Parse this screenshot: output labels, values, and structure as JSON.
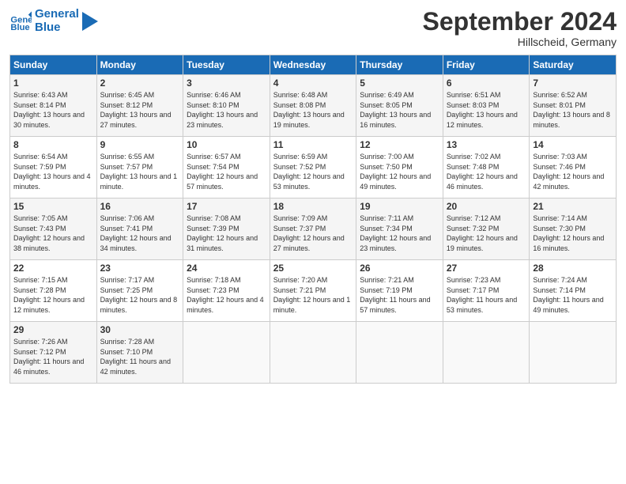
{
  "logo": {
    "general": "General",
    "blue": "Blue"
  },
  "header": {
    "title": "September 2024",
    "subtitle": "Hillscheid, Germany"
  },
  "columns": [
    "Sunday",
    "Monday",
    "Tuesday",
    "Wednesday",
    "Thursday",
    "Friday",
    "Saturday"
  ],
  "weeks": [
    [
      {
        "day": "1",
        "sunrise": "Sunrise: 6:43 AM",
        "sunset": "Sunset: 8:14 PM",
        "daylight": "Daylight: 13 hours and 30 minutes."
      },
      {
        "day": "2",
        "sunrise": "Sunrise: 6:45 AM",
        "sunset": "Sunset: 8:12 PM",
        "daylight": "Daylight: 13 hours and 27 minutes."
      },
      {
        "day": "3",
        "sunrise": "Sunrise: 6:46 AM",
        "sunset": "Sunset: 8:10 PM",
        "daylight": "Daylight: 13 hours and 23 minutes."
      },
      {
        "day": "4",
        "sunrise": "Sunrise: 6:48 AM",
        "sunset": "Sunset: 8:08 PM",
        "daylight": "Daylight: 13 hours and 19 minutes."
      },
      {
        "day": "5",
        "sunrise": "Sunrise: 6:49 AM",
        "sunset": "Sunset: 8:05 PM",
        "daylight": "Daylight: 13 hours and 16 minutes."
      },
      {
        "day": "6",
        "sunrise": "Sunrise: 6:51 AM",
        "sunset": "Sunset: 8:03 PM",
        "daylight": "Daylight: 13 hours and 12 minutes."
      },
      {
        "day": "7",
        "sunrise": "Sunrise: 6:52 AM",
        "sunset": "Sunset: 8:01 PM",
        "daylight": "Daylight: 13 hours and 8 minutes."
      }
    ],
    [
      {
        "day": "8",
        "sunrise": "Sunrise: 6:54 AM",
        "sunset": "Sunset: 7:59 PM",
        "daylight": "Daylight: 13 hours and 4 minutes."
      },
      {
        "day": "9",
        "sunrise": "Sunrise: 6:55 AM",
        "sunset": "Sunset: 7:57 PM",
        "daylight": "Daylight: 13 hours and 1 minute."
      },
      {
        "day": "10",
        "sunrise": "Sunrise: 6:57 AM",
        "sunset": "Sunset: 7:54 PM",
        "daylight": "Daylight: 12 hours and 57 minutes."
      },
      {
        "day": "11",
        "sunrise": "Sunrise: 6:59 AM",
        "sunset": "Sunset: 7:52 PM",
        "daylight": "Daylight: 12 hours and 53 minutes."
      },
      {
        "day": "12",
        "sunrise": "Sunrise: 7:00 AM",
        "sunset": "Sunset: 7:50 PM",
        "daylight": "Daylight: 12 hours and 49 minutes."
      },
      {
        "day": "13",
        "sunrise": "Sunrise: 7:02 AM",
        "sunset": "Sunset: 7:48 PM",
        "daylight": "Daylight: 12 hours and 46 minutes."
      },
      {
        "day": "14",
        "sunrise": "Sunrise: 7:03 AM",
        "sunset": "Sunset: 7:46 PM",
        "daylight": "Daylight: 12 hours and 42 minutes."
      }
    ],
    [
      {
        "day": "15",
        "sunrise": "Sunrise: 7:05 AM",
        "sunset": "Sunset: 7:43 PM",
        "daylight": "Daylight: 12 hours and 38 minutes."
      },
      {
        "day": "16",
        "sunrise": "Sunrise: 7:06 AM",
        "sunset": "Sunset: 7:41 PM",
        "daylight": "Daylight: 12 hours and 34 minutes."
      },
      {
        "day": "17",
        "sunrise": "Sunrise: 7:08 AM",
        "sunset": "Sunset: 7:39 PM",
        "daylight": "Daylight: 12 hours and 31 minutes."
      },
      {
        "day": "18",
        "sunrise": "Sunrise: 7:09 AM",
        "sunset": "Sunset: 7:37 PM",
        "daylight": "Daylight: 12 hours and 27 minutes."
      },
      {
        "day": "19",
        "sunrise": "Sunrise: 7:11 AM",
        "sunset": "Sunset: 7:34 PM",
        "daylight": "Daylight: 12 hours and 23 minutes."
      },
      {
        "day": "20",
        "sunrise": "Sunrise: 7:12 AM",
        "sunset": "Sunset: 7:32 PM",
        "daylight": "Daylight: 12 hours and 19 minutes."
      },
      {
        "day": "21",
        "sunrise": "Sunrise: 7:14 AM",
        "sunset": "Sunset: 7:30 PM",
        "daylight": "Daylight: 12 hours and 16 minutes."
      }
    ],
    [
      {
        "day": "22",
        "sunrise": "Sunrise: 7:15 AM",
        "sunset": "Sunset: 7:28 PM",
        "daylight": "Daylight: 12 hours and 12 minutes."
      },
      {
        "day": "23",
        "sunrise": "Sunrise: 7:17 AM",
        "sunset": "Sunset: 7:25 PM",
        "daylight": "Daylight: 12 hours and 8 minutes."
      },
      {
        "day": "24",
        "sunrise": "Sunrise: 7:18 AM",
        "sunset": "Sunset: 7:23 PM",
        "daylight": "Daylight: 12 hours and 4 minutes."
      },
      {
        "day": "25",
        "sunrise": "Sunrise: 7:20 AM",
        "sunset": "Sunset: 7:21 PM",
        "daylight": "Daylight: 12 hours and 1 minute."
      },
      {
        "day": "26",
        "sunrise": "Sunrise: 7:21 AM",
        "sunset": "Sunset: 7:19 PM",
        "daylight": "Daylight: 11 hours and 57 minutes."
      },
      {
        "day": "27",
        "sunrise": "Sunrise: 7:23 AM",
        "sunset": "Sunset: 7:17 PM",
        "daylight": "Daylight: 11 hours and 53 minutes."
      },
      {
        "day": "28",
        "sunrise": "Sunrise: 7:24 AM",
        "sunset": "Sunset: 7:14 PM",
        "daylight": "Daylight: 11 hours and 49 minutes."
      }
    ],
    [
      {
        "day": "29",
        "sunrise": "Sunrise: 7:26 AM",
        "sunset": "Sunset: 7:12 PM",
        "daylight": "Daylight: 11 hours and 46 minutes."
      },
      {
        "day": "30",
        "sunrise": "Sunrise: 7:28 AM",
        "sunset": "Sunset: 7:10 PM",
        "daylight": "Daylight: 11 hours and 42 minutes."
      },
      null,
      null,
      null,
      null,
      null
    ]
  ]
}
